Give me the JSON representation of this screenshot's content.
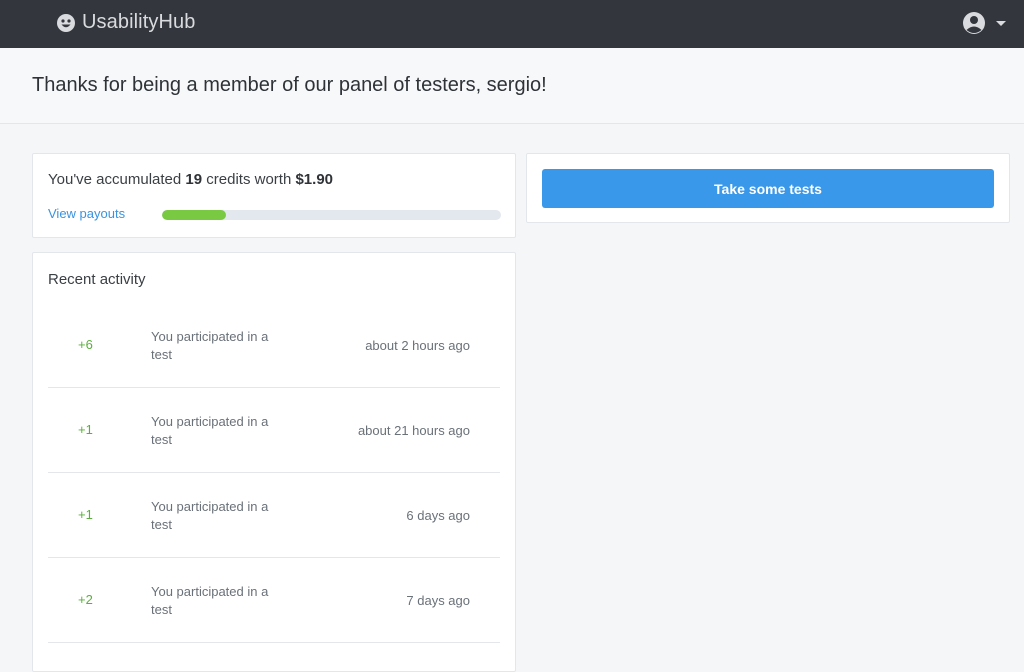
{
  "header": {
    "brand": "UsabilityHub",
    "logo_icon": "usabilityhub-logo-icon",
    "user_icon": "user-avatar-icon",
    "menu_icon": "caret-down-icon"
  },
  "page": {
    "title": "Thanks for being a member of our panel of testers, sergio!"
  },
  "credits": {
    "prefix": "You've accumulated ",
    "count": "19",
    "middle": " credits worth ",
    "worth": "$1.90",
    "view_payouts_label": "View payouts",
    "progress_fraction": 0.19,
    "progress_color": "#7ac943"
  },
  "tests": {
    "button_label": "Take some tests",
    "button_color": "#3998ea"
  },
  "activity": {
    "title": "Recent activity",
    "items": [
      {
        "credits": "+6",
        "description": "You participated in a test",
        "time": "about 2 hours ago"
      },
      {
        "credits": "+1",
        "description": "You participated in a test",
        "time": "about 21 hours ago"
      },
      {
        "credits": "+1",
        "description": "You participated in a test",
        "time": "6 days ago"
      },
      {
        "credits": "+2",
        "description": "You participated in a test",
        "time": "7 days ago"
      }
    ]
  }
}
